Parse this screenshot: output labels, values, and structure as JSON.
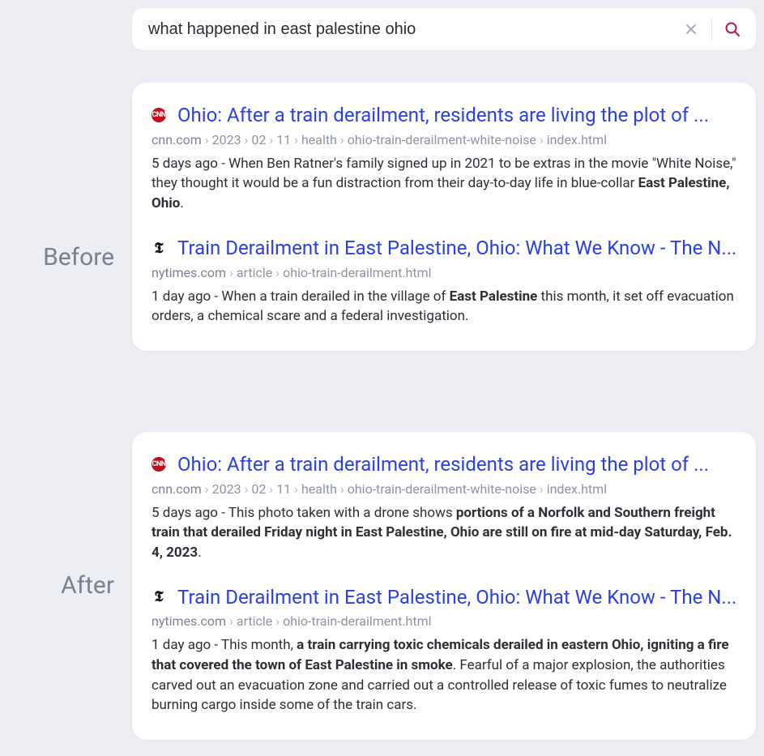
{
  "search": {
    "query": "what happened in east palestine ohio"
  },
  "labels": {
    "before": "Before",
    "after": "After"
  },
  "panels": {
    "before": {
      "results": [
        {
          "favicon": "cnn",
          "favicon_text": "CNN",
          "title": "Ohio: After a train derailment, residents are living the plot of ...",
          "crumb_domain": "cnn.com",
          "crumb_parts": [
            "2023",
            "02",
            "11",
            "health",
            "ohio-train-derailment-white-noise",
            "index.html"
          ],
          "age": "5 days ago",
          "snippet_pre": "When Ben Ratner's family signed up in 2021 to be extras in the movie \"White Noise,\" they thought it would be a fun distraction from their day-to-day life in blue-collar ",
          "snippet_bold": "East Palestine, Ohio",
          "snippet_post": "."
        },
        {
          "favicon": "nyt",
          "favicon_text": "𝕿",
          "title": "Train Derailment in East Palestine, Ohio: What We Know - The N...",
          "crumb_domain": "nytimes.com",
          "crumb_parts": [
            "article",
            "ohio-train-derailment.html"
          ],
          "age": "1 day ago",
          "snippet_pre": "When a train derailed in the village of ",
          "snippet_bold": "East Palestine",
          "snippet_post": " this month, it set off evacuation orders, a chemical scare and a federal investigation."
        }
      ]
    },
    "after": {
      "results": [
        {
          "favicon": "cnn",
          "favicon_text": "CNN",
          "title": "Ohio: After a train derailment, residents are living the plot of ...",
          "crumb_domain": "cnn.com",
          "crumb_parts": [
            "2023",
            "02",
            "11",
            "health",
            "ohio-train-derailment-white-noise",
            "index.html"
          ],
          "age": "5 days ago",
          "snippet_pre": "This photo taken with a drone shows ",
          "snippet_bold": "portions of a Norfolk and Southern freight train that derailed Friday night in East Palestine, Ohio are still on fire at mid-day Saturday, Feb. 4, 2023",
          "snippet_post": "."
        },
        {
          "favicon": "nyt",
          "favicon_text": "𝕿",
          "title": "Train Derailment in East Palestine, Ohio: What We Know - The N...",
          "crumb_domain": "nytimes.com",
          "crumb_parts": [
            "article",
            "ohio-train-derailment.html"
          ],
          "age": "1 day ago",
          "snippet_pre": "This month, ",
          "snippet_bold": "a train carrying toxic chemicals derailed in eastern Ohio, igniting a fire that covered the town of East Palestine in smoke",
          "snippet_post": ". Fearful of a major explosion, the authorities carved out an evacuation zone and carried out a controlled release of toxic fumes to neutralize burning cargo inside some of the train cars."
        }
      ]
    }
  }
}
